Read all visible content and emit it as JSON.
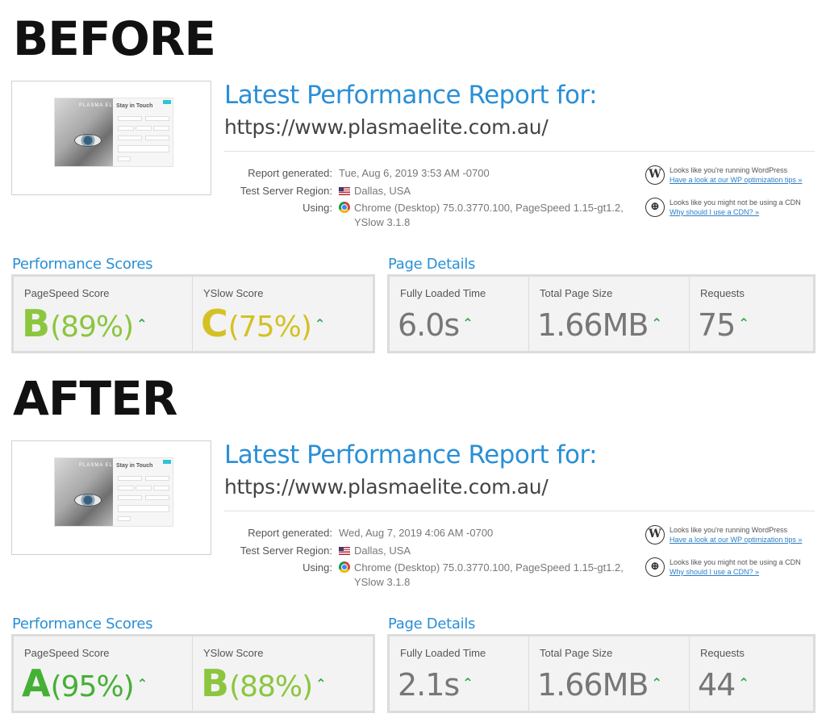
{
  "colors": {
    "title_blue": "#2a8fd6",
    "grade_a": "#45b035",
    "grade_b": "#8cc63f",
    "grade_c": "#d4c125",
    "up_arrow": "#2aa84a"
  },
  "thumbnail": {
    "form_title": "Stay in Touch",
    "logo_text": "PLASMA ELITE"
  },
  "reports": [
    {
      "label": "BEFORE",
      "title": "Latest Performance Report for:",
      "url": "https://www.plasmaelite.com.au/",
      "meta": {
        "generated_key": "Report generated:",
        "generated_val": "Tue, Aug 6, 2019 3:53 AM -0700",
        "region_key": "Test Server Region:",
        "region_val": "Dallas, USA",
        "using_key": "Using:",
        "using_val_1": "Chrome (Desktop) 75.0.3770.100, PageSpeed 1.15-gt1.2,",
        "using_val_2": "YSlow 3.1.8"
      },
      "notes": [
        {
          "icon": "wordpress-icon",
          "text": "Looks like you're running WordPress",
          "link": "Have a look at our WP optimization tips »"
        },
        {
          "icon": "globe-icon",
          "text": "Looks like you might not be using a CDN",
          "link": "Why should I use a CDN? »"
        }
      ],
      "perf_heading": "Performance Scores",
      "page_heading": "Page Details",
      "pagespeed": {
        "label": "PageSpeed Score",
        "grade": "B",
        "percent": "(89%)",
        "grade_color": "#8cc63f"
      },
      "yslow": {
        "label": "YSlow Score",
        "grade": "C",
        "percent": "(75%)",
        "grade_color": "#d4c125"
      },
      "details": [
        {
          "label": "Fully Loaded Time",
          "value": "6.0s"
        },
        {
          "label": "Total Page Size",
          "value": "1.66MB"
        },
        {
          "label": "Requests",
          "value": "75"
        }
      ]
    },
    {
      "label": "AFTER",
      "title": "Latest Performance Report for:",
      "url": "https://www.plasmaelite.com.au/",
      "meta": {
        "generated_key": "Report generated:",
        "generated_val": "Wed, Aug 7, 2019 4:06 AM -0700",
        "region_key": "Test Server Region:",
        "region_val": "Dallas, USA",
        "using_key": "Using:",
        "using_val_1": "Chrome (Desktop) 75.0.3770.100, PageSpeed 1.15-gt1.2,",
        "using_val_2": "YSlow 3.1.8"
      },
      "notes": [
        {
          "icon": "wordpress-icon",
          "text": "Looks like you're running WordPress",
          "link": "Have a look at our WP optimization tips »"
        },
        {
          "icon": "globe-icon",
          "text": "Looks like you might not be using a CDN",
          "link": "Why should I use a CDN? »"
        }
      ],
      "perf_heading": "Performance Scores",
      "page_heading": "Page Details",
      "pagespeed": {
        "label": "PageSpeed Score",
        "grade": "A",
        "percent": "(95%)",
        "grade_color": "#45b035"
      },
      "yslow": {
        "label": "YSlow Score",
        "grade": "B",
        "percent": "(88%)",
        "grade_color": "#8cc63f"
      },
      "details": [
        {
          "label": "Fully Loaded Time",
          "value": "2.1s"
        },
        {
          "label": "Total Page Size",
          "value": "1.66MB"
        },
        {
          "label": "Requests",
          "value": "44"
        }
      ]
    }
  ]
}
